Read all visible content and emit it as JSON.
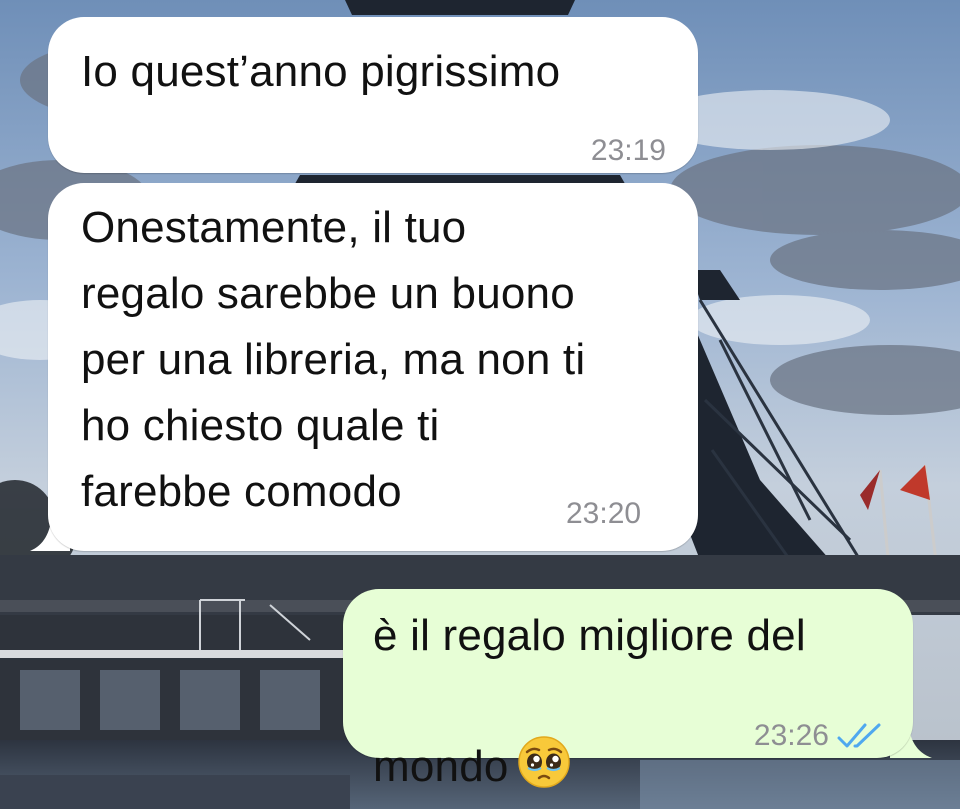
{
  "chat": {
    "messages": [
      {
        "direction": "incoming",
        "text": "Io quest’anno pigrissimo",
        "time": "23:19"
      },
      {
        "direction": "incoming",
        "text": "Onestamente, il tuo\nregalo sarebbe un buono\nper una libreria, ma non ti\nho chiesto quale ti\nfarebbe comodo",
        "time": "23:20"
      },
      {
        "direction": "outgoing",
        "text_line1": "è il regalo migliore del",
        "text_line2": "mondo",
        "emoji": "pleading-face",
        "time": "23:26",
        "status": "read"
      }
    ]
  },
  "colors": {
    "incoming_bubble": "#ffffff",
    "outgoing_bubble": "#e7fed6",
    "timestamp": "#8e8e93",
    "read_ticks": "#4fa8ef"
  },
  "icons": {
    "read_receipt": "double-check-icon",
    "emoji": "pleading-face-emoji"
  }
}
